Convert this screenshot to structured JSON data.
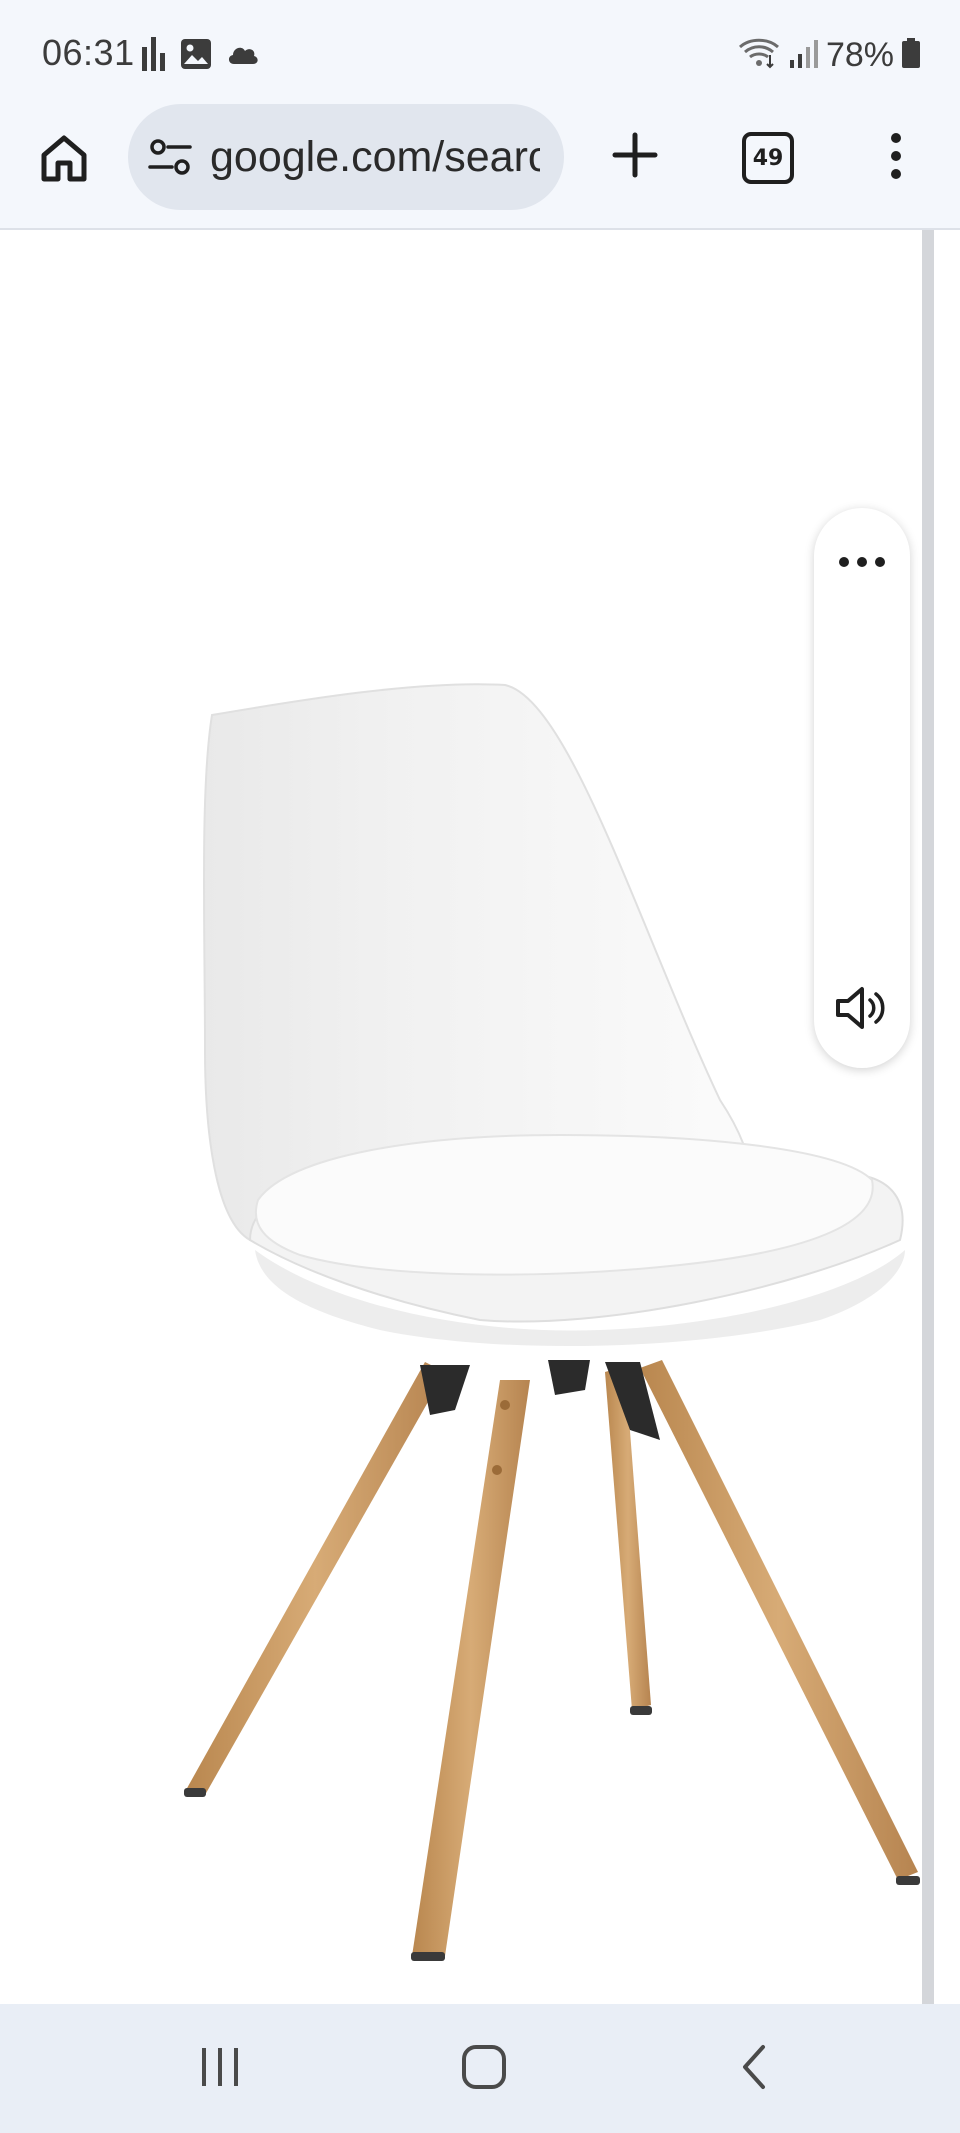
{
  "status_bar": {
    "time": "06:31",
    "battery": "78%",
    "left_icons": [
      "activity-bars-icon",
      "gallery-icon",
      "cloud-icon"
    ],
    "right_icons": [
      "wifi-icon",
      "signal-icon",
      "battery-icon"
    ]
  },
  "toolbar": {
    "url": "google.com/search",
    "tab_count": "49",
    "icons": {
      "home": "home-icon",
      "site_settings": "tune-icon",
      "new_tab": "plus-icon",
      "menu": "more-vert-icon"
    }
  },
  "content": {
    "image_subject": "white shell chair with wooden legs",
    "side_rail": {
      "more": "more-horiz-icon",
      "speaker": "speaker-icon"
    }
  },
  "nav_bar": {
    "icons": [
      "recents-icon",
      "home-outline-icon",
      "back-icon"
    ]
  },
  "colors": {
    "chrome_bg": "#f4f7fc",
    "omnibox_bg": "#e1e6ee",
    "nav_bg": "#e9eef6",
    "wood": "#c99a62"
  }
}
